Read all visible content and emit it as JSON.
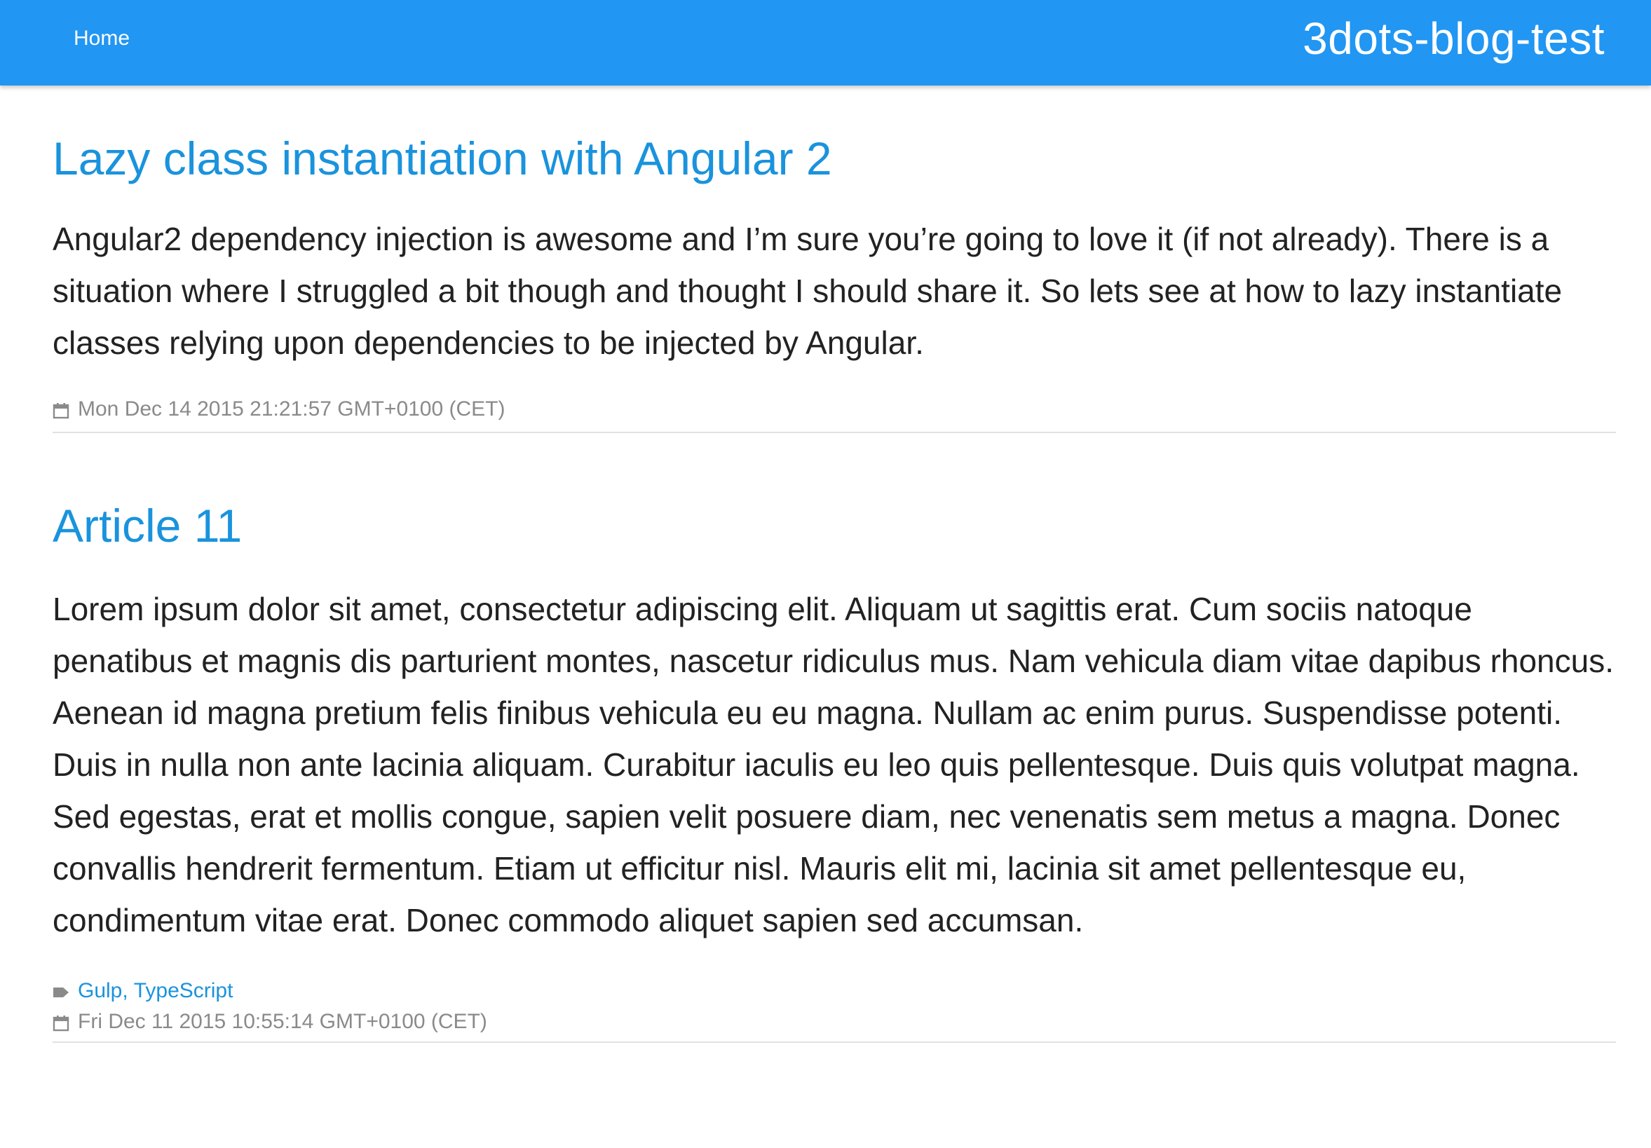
{
  "header": {
    "nav_home": "Home",
    "site_title": "3dots-blog-test"
  },
  "articles": [
    {
      "title": "Lazy class instantiation with Angular 2",
      "excerpt": "Angular2 dependency injection is awesome and I’m sure you’re going to love it (if not already). There is a situation where I struggled a bit though and thought I should share it. So lets see at how to lazy instantiate classes relying upon dependencies to be injected by Angular.",
      "tags": [],
      "date": "Mon Dec 14 2015 21:21:57 GMT+0100 (CET)"
    },
    {
      "title": "Article 11",
      "excerpt": "Lorem ipsum dolor sit amet, consectetur adipiscing elit. Aliquam ut sagittis erat. Cum sociis natoque penatibus et magnis dis parturient montes, nascetur ridiculus mus. Nam vehicula diam vitae dapibus rhoncus. Aenean id magna pretium felis finibus vehicula eu eu magna. Nullam ac enim purus. Suspendisse potenti. Duis in nulla non ante lacinia aliquam. Curabitur iaculis eu leo quis pellentesque. Duis quis volutpat magna. Sed egestas, erat et mollis congue, sapien velit posuere diam, nec venenatis sem metus a magna. Donec convallis hendrerit fermentum. Etiam ut efficitur nisl. Mauris elit mi, lacinia sit amet pellentesque eu, condimentum vitae erat. Donec commodo aliquet sapien sed accumsan.",
      "tags": [
        "Gulp",
        "TypeScript"
      ],
      "tag_separator": ",",
      "date": "Fri Dec 11 2015 10:55:14 GMT+0100 (CET)"
    }
  ],
  "icons": {
    "calendar": "calendar-icon",
    "tag": "tag-icon"
  },
  "colors": {
    "header_bg": "#2196f3",
    "link": "#1a93dd",
    "meta_text": "#8a8a8a"
  }
}
